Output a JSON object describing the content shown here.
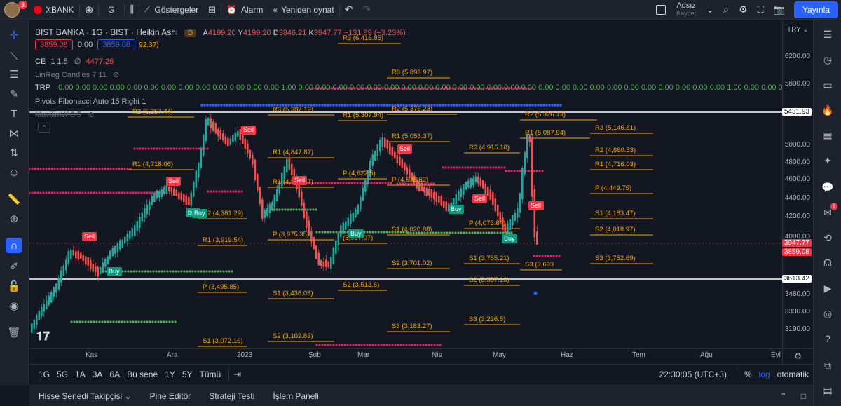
{
  "topbar": {
    "avatar_badge": "3",
    "symbol": "XBANK",
    "interval": "G",
    "indicators": "Göstergeler",
    "alert": "Alarm",
    "replay": "Yeniden oynat",
    "account_name": "Adsız",
    "account_sub": "Kaydet",
    "publish": "Yayınla"
  },
  "legend": {
    "title": "BIST BANKA · 1G · BIST · Heikin Ashi",
    "d_badge": "D",
    "ohlc": [
      {
        "k": "A",
        "v": "4199.20"
      },
      {
        "k": "Y",
        "v": "4199.20"
      },
      {
        "k": "D",
        "v": "3846.21"
      },
      {
        "k": "K",
        "v": "3947.77"
      }
    ],
    "change": "−131.89 (−3.23%)",
    "bid": "3859.08",
    "spread": "0.00",
    "ask": "3859.08",
    "r3_partial": "92.37)",
    "ce_name": "CE",
    "ce_params": "1 1.5",
    "ce_value": "4477.26",
    "linreg": "LinReg Candles 7 11",
    "trp_name": "TRP",
    "trp_values": "0.00 0.00 0.00 0.00 0.00 0.00 0.00 0.00 0.00 0.00 0.00 0.00 0.00 1.00 0.00 0.00 0.00 0.00 0.00 0.00 0.00 0.00 0.00 0.00 0.00 0.00 0.00 0.00 0.00 0.00 0.00 0.00 0.00 0.00 0.00 0.00 0.00 0.00 0.00 1.00 0.00 0.00 0.00 0.00 0.00 0.00",
    "pivots": "Pivots Fibonacci Auto 15 Right 1",
    "mavilim": "MavilimW 3 5"
  },
  "currency": "TRY",
  "price_axis": [
    "6200.00",
    "5800.00",
    "5431.93",
    "5000.00",
    "4800.00",
    "4600.00",
    "4400.00",
    "4200.00",
    "4000.00",
    "3947.77",
    "3859.08",
    "3613.42",
    "3480.00",
    "3330.00",
    "3190.00"
  ],
  "price_tags": [
    {
      "v": "5431.93",
      "bg": "#ffffff",
      "fg": "#131722"
    },
    {
      "v": "3947.77",
      "bg": "#f23645",
      "fg": "#ffffff"
    },
    {
      "v": "3859.08",
      "bg": "#f23645",
      "fg": "#ffffff"
    },
    {
      "v": "3613.42",
      "bg": "#ffffff",
      "fg": "#131722"
    }
  ],
  "time_axis": [
    "Kas",
    "Ara",
    "2023",
    "Şub",
    "Mar",
    "Nis",
    "May",
    "Haz",
    "Tem",
    "Ağu",
    "Eyl"
  ],
  "ranges": [
    "1G",
    "5G",
    "1A",
    "3A",
    "6A",
    "Bu sene",
    "1Y",
    "5Y",
    "Tümü"
  ],
  "clock": "22:30:05 (UTC+3)",
  "scale_opts": [
    "%",
    "log",
    "otomatik"
  ],
  "bottom_tabs": [
    "Hisse Senedi Takipçisi",
    "Pine Editör",
    "Strateji Testi",
    "İşlem Paneli"
  ],
  "rightbar_badge": "1",
  "pivot_labels": [
    {
      "t": "R3 (6,416.85)",
      "c": "#f7a600"
    },
    {
      "t": "R2 (5,357.44)",
      "c": "#f7a600"
    },
    {
      "t": "R3 (5,387.19)",
      "c": "#f7a600"
    },
    {
      "t": "R3 (5,893.97)",
      "c": "#f7a600"
    },
    {
      "t": "R2 (5,376.23)",
      "c": "#f7a600"
    },
    {
      "t": "R1 (5,307.94)",
      "c": "#f7a600"
    },
    {
      "t": "R1 (5,056.37)",
      "c": "#f7a600"
    },
    {
      "t": "R2 (5,326.13)",
      "c": "#f7a600"
    },
    {
      "t": "R3 (5,146.81)",
      "c": "#f7a600"
    },
    {
      "t": "R1 (5,087.94)",
      "c": "#f7a600"
    },
    {
      "t": "R2 (4,880.53)",
      "c": "#f7a600"
    },
    {
      "t": "R3 (4,915.18)",
      "c": "#f7a600"
    },
    {
      "t": "R1 (4,847.87)",
      "c": "#f7a600"
    },
    {
      "t": "R1 (4,718.06)",
      "c": "#f7a600"
    },
    {
      "t": "R1 (4,716.03)",
      "c": "#f7a600"
    },
    {
      "t": "P (4,622.5)",
      "c": "#f7a600"
    },
    {
      "t": "P (4,538.62)",
      "c": "#f7a600"
    },
    {
      "t": "R1 (4,514.67)",
      "c": "#f7a600"
    },
    {
      "t": "P (4,449.75)",
      "c": "#f7a600"
    },
    {
      "t": "R2 (4,381.29)",
      "c": "#f7a600"
    },
    {
      "t": "S1 (4,183.47)",
      "c": "#f7a600"
    },
    {
      "t": "P (4,075.84)",
      "c": "#f7a600"
    },
    {
      "t": "S1 (4,020.88)",
      "c": "#f7a600"
    },
    {
      "t": "S2 (4,018.97)",
      "c": "#f7a600"
    },
    {
      "t": "P (3,975.35)",
      "c": "#f7a600"
    },
    {
      "t": "R1 (3,919.54)",
      "c": "#f7a600"
    },
    {
      "t": "(3,937.07)",
      "c": "#f7a600"
    },
    {
      "t": "S1 (3,755.21)",
      "c": "#f7a600"
    },
    {
      "t": "S3 (3,752.69)",
      "c": "#f7a600"
    },
    {
      "t": "S2 (3,701.02)",
      "c": "#f7a600"
    },
    {
      "t": "S3 (3,693",
      "c": "#f7a600"
    },
    {
      "t": "S2 (3,557.13)",
      "c": "#f7a600"
    },
    {
      "t": "S2 (3,513.6)",
      "c": "#f7a600"
    },
    {
      "t": "P (3,495.85)",
      "c": "#f7a600"
    },
    {
      "t": "S1 (3,436.03)",
      "c": "#f7a600"
    },
    {
      "t": "S3 (3,236.5)",
      "c": "#f7a600"
    },
    {
      "t": "S3 (3,183.27)",
      "c": "#f7a600"
    },
    {
      "t": "S2 (3,102.83)",
      "c": "#f7a600"
    },
    {
      "t": "S1 (3,072.16)",
      "c": "#f7a600"
    }
  ],
  "signals": [
    {
      "t": "Sell",
      "c": "#f23645"
    },
    {
      "t": "Buy",
      "c": "#089981"
    },
    {
      "t": "Sell",
      "c": "#f23645"
    },
    {
      "t": "buy",
      "c": "#089981"
    },
    {
      "t": "Sell",
      "c": "#f23645"
    },
    {
      "t": "Sell",
      "c": "#f23645"
    },
    {
      "t": "Buy",
      "c": "#089981"
    },
    {
      "t": "Buy",
      "c": "#089981"
    },
    {
      "t": "Sell",
      "c": "#f23645"
    },
    {
      "t": "Sell",
      "c": "#f23645"
    },
    {
      "t": "Buy",
      "c": "#089981"
    },
    {
      "t": "Sell",
      "c": "#f23645"
    },
    {
      "t": "Buy",
      "c": "#089981"
    },
    {
      "t": "Sell",
      "c": "#f23645"
    }
  ],
  "colors": {
    "bg": "#131722",
    "panel": "#1e222d",
    "up": "#26a69a",
    "down": "#ef5350",
    "pivot": "#f7a600",
    "blue_line": "#2962ff",
    "green_dots": "#4caf50",
    "magenta_dots": "#e91e63",
    "publish": "#2962ff"
  }
}
